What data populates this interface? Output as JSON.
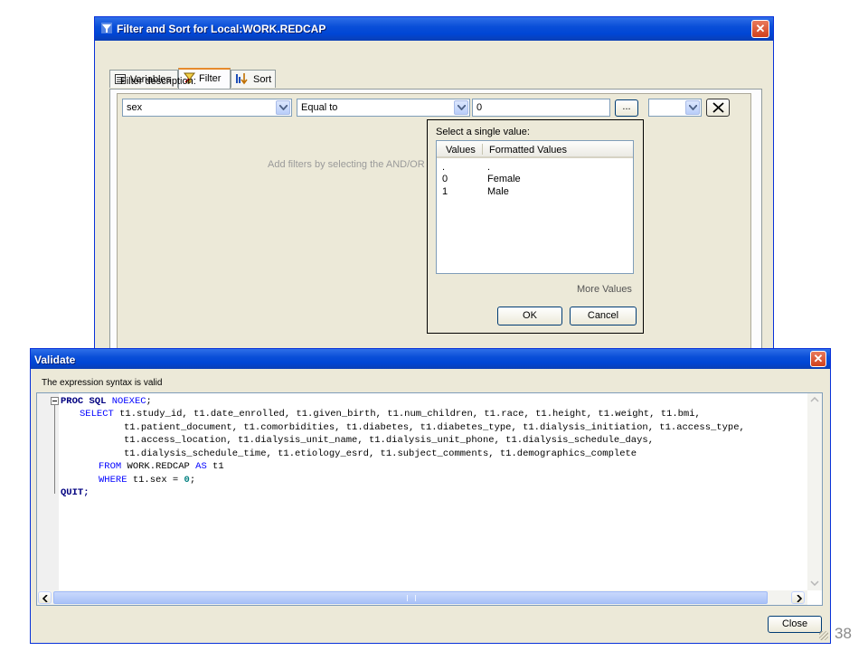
{
  "filter_window": {
    "title": "Filter and Sort for Local:WORK.REDCAP",
    "tabs": [
      {
        "label": "Variables"
      },
      {
        "label": "Filter"
      },
      {
        "label": "Sort"
      }
    ],
    "filter_description_label": "Filter description:",
    "variable_value": "sex",
    "operator_value": "Equal to",
    "value_input": "0",
    "browse_label": "...",
    "connector_value": "",
    "hint_text": "Add filters by selecting the AND/OR c"
  },
  "value_popup": {
    "prompt": "Select a single value:",
    "columns": [
      "Values",
      "Formatted Values"
    ],
    "rows": [
      {
        "value": ".",
        "formatted": "."
      },
      {
        "value": "0",
        "formatted": "Female"
      },
      {
        "value": "1",
        "formatted": "Male"
      }
    ],
    "more_values_label": "More Values",
    "ok_label": "OK",
    "cancel_label": "Cancel"
  },
  "validate_window": {
    "title": "Validate",
    "status": "The expression syntax is valid",
    "close_label": "Close",
    "code": {
      "l1_kw": "PROC SQL",
      "l1_opt": "NOEXEC",
      "l1_end": ";",
      "l2_kw": "SELECT",
      "l2_rest": " t1.study_id, t1.date_enrolled, t1.given_birth, t1.num_children, t1.race, t1.height, t1.weight, t1.bmi,",
      "l3": "t1.patient_document, t1.comorbidities, t1.diabetes, t1.diabetes_type, t1.dialysis_initiation, t1.access_type,",
      "l4": "t1.access_location, t1.dialysis_unit_name, t1.dialysis_unit_phone, t1.dialysis_schedule_days,",
      "l5": "t1.dialysis_schedule_time, t1.etiology_esrd, t1.subject_comments, t1.demographics_complete",
      "l6_kw": "FROM",
      "l6_mid": " WORK.REDCAP ",
      "l6_as": "AS",
      "l6_end": " t1",
      "l7_kw": "WHERE",
      "l7_mid": " t1.sex = ",
      "l7_num": "0",
      "l7_end": ";",
      "l8": "QUIT;"
    }
  },
  "page_number": "38"
}
